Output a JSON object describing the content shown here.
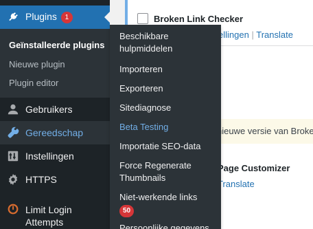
{
  "sidebar": {
    "plugins_label": "Plugins",
    "plugins_badge": "1",
    "submenu": [
      "Geïnstalleerde plugins",
      "Nieuwe plugin",
      "Plugin editor"
    ],
    "gebruikers_label": "Gebruikers",
    "gereedschap_label": "Gereedschap",
    "instellingen_label": "Instellingen",
    "https_label": "HTTPS",
    "limit_login_label_1": "Limit Login",
    "limit_login_label_2": "Attempts"
  },
  "flyout": {
    "items": [
      "Beschikbare hulpmiddelen",
      "Importeren",
      "Exporteren",
      "Sitediagnose",
      "Beta Testing",
      "Importatie SEO-data",
      "Force Regenerate Thumbnails",
      "Niet-werkende links",
      "Persoonlijke gegevens"
    ],
    "broken_links_badge": "50"
  },
  "content": {
    "plugin1_title": "Broken Link Checker",
    "plugin1_link1": "ellingen",
    "plugin1_sep": "|",
    "plugin1_link2": "Translate",
    "notice_text": "nieuwe versie van Broke",
    "plugin2_title": "Page Customizer",
    "plugin2_link": "Translate"
  },
  "colors": {
    "sidebar_bg": "#1d2327",
    "active_bg": "#2271b1",
    "flyout_bg": "#2c3338",
    "accent": "#72aee6",
    "badge": "#d63638"
  }
}
